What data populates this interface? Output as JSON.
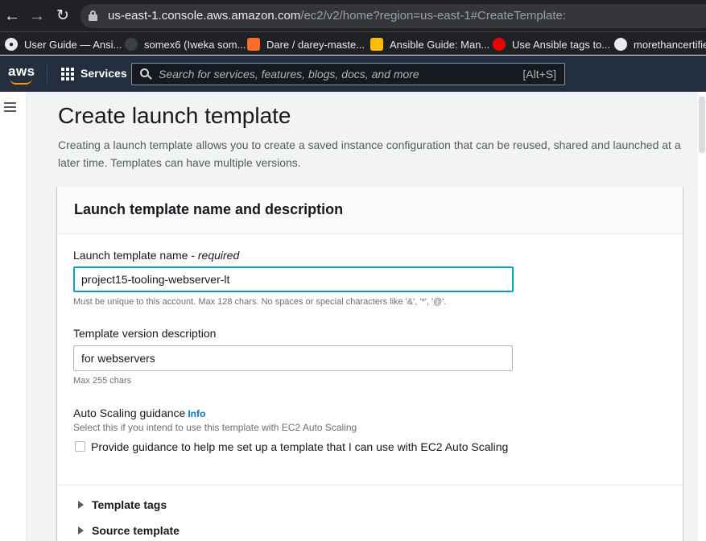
{
  "browser": {
    "url_host": "us-east-1.console.aws.amazon.com",
    "url_path": "/ec2/v2/home?region=us-east-1#CreateTemplate:",
    "bookmarks": [
      {
        "label": "User Guide — Ansi...",
        "icon": "globe-icon"
      },
      {
        "label": "somex6 (Iweka som...",
        "icon": "github-icon"
      },
      {
        "label": "Dare / darey-maste...",
        "icon": "gitlab-icon"
      },
      {
        "label": "Ansible Guide: Man...",
        "icon": "lightbulb-icon"
      },
      {
        "label": "Use Ansible tags to...",
        "icon": "redhat-icon"
      },
      {
        "label": "morethancertified",
        "icon": "github-icon"
      }
    ]
  },
  "aws_header": {
    "logo": "aws",
    "services_label": "Services",
    "search_placeholder": "Search for services, features, blogs, docs, and more",
    "search_shortcut": "[Alt+S]"
  },
  "page": {
    "title": "Create launch template",
    "description": "Creating a launch template allows you to create a saved instance configuration that can be reused, shared and launched at a later time. Templates can have multiple versions."
  },
  "panel": {
    "title": "Launch template name and description",
    "name_field": {
      "label": "Launch template name - ",
      "required": "required",
      "value": "project15-tooling-webserver-lt",
      "constraint": "Must be unique to this account. Max 128 chars. No spaces or special characters like '&', '*', '@'."
    },
    "version_field": {
      "label": "Template version description",
      "value": "for webservers",
      "constraint": "Max 255 chars"
    },
    "autoscaling": {
      "label": "Auto Scaling guidance",
      "info": "Info",
      "description": "Select this if you intend to use this template with EC2 Auto Scaling",
      "checkbox_label": "Provide guidance to help me set up a template that I can use with EC2 Auto Scaling",
      "checked": false
    },
    "expanders": [
      {
        "label": "Template tags"
      },
      {
        "label": "Source template"
      }
    ]
  }
}
